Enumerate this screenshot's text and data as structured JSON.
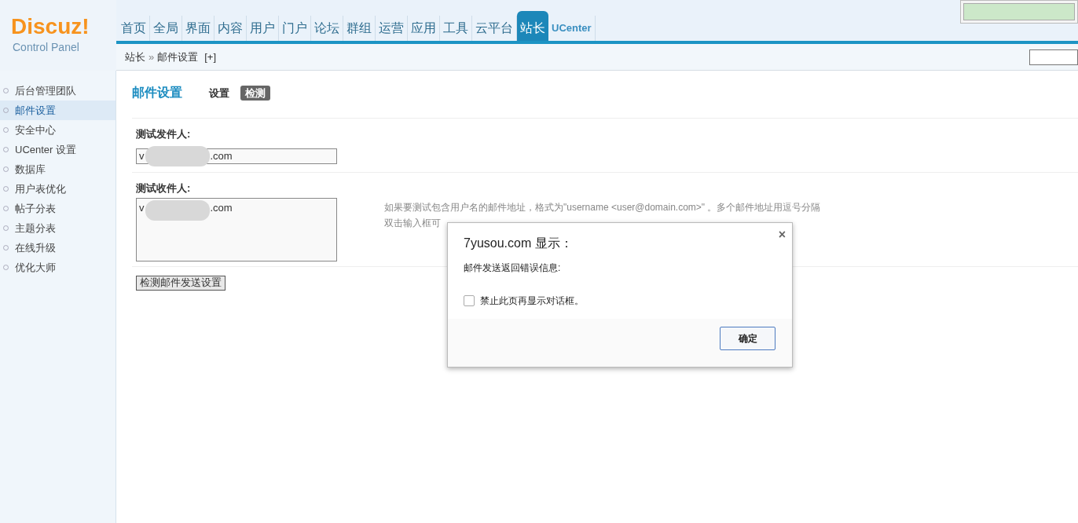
{
  "logo": {
    "title": "Discuz!",
    "subtitle": "Control Panel"
  },
  "nav": [
    {
      "label": "首页",
      "selected": false
    },
    {
      "label": "全局",
      "selected": false
    },
    {
      "label": "界面",
      "selected": false
    },
    {
      "label": "内容",
      "selected": false
    },
    {
      "label": "用户",
      "selected": false
    },
    {
      "label": "门户",
      "selected": false
    },
    {
      "label": "论坛",
      "selected": false
    },
    {
      "label": "群组",
      "selected": false
    },
    {
      "label": "运营",
      "selected": false
    },
    {
      "label": "应用",
      "selected": false
    },
    {
      "label": "工具",
      "selected": false
    },
    {
      "label": "云平台",
      "selected": false
    },
    {
      "label": "站长",
      "selected": true
    },
    {
      "label": "UCenter",
      "selected": false
    }
  ],
  "breadcrumb": {
    "parent": "站长",
    "separator": "»",
    "current": "邮件设置",
    "add": "[+]"
  },
  "sidebar": [
    {
      "label": "后台管理团队",
      "selected": false
    },
    {
      "label": "邮件设置",
      "selected": true
    },
    {
      "label": "安全中心",
      "selected": false
    },
    {
      "label": "UCenter 设置",
      "selected": false
    },
    {
      "label": "数据库",
      "selected": false
    },
    {
      "label": "用户表优化",
      "selected": false
    },
    {
      "label": "帖子分表",
      "selected": false
    },
    {
      "label": "主题分表",
      "selected": false
    },
    {
      "label": "在线升级",
      "selected": false
    },
    {
      "label": "优化大师",
      "selected": false
    }
  ],
  "page": {
    "title": "邮件设置",
    "tabs": [
      {
        "label": "设置",
        "selected": false
      },
      {
        "label": "检测",
        "selected": true
      }
    ]
  },
  "form": {
    "sender": {
      "label": "测试发件人:",
      "value_start": "v",
      "value_end": ".com"
    },
    "recipient": {
      "label": "测试收件人:",
      "value_start": "v",
      "value_end": ".com",
      "hint": [
        "如果要测试包含用户名的邮件地址，格式为\"username <user@domain.com>\" 。多个邮件地址用逗号分隔",
        "双击输入框可"
      ]
    },
    "submit": "检测邮件发送设置"
  },
  "dialog": {
    "title": "7yusou.com 显示：",
    "close": "×",
    "message": "邮件发送返回错误信息:",
    "checkbox": {
      "label": "禁止此页再显示对话框。",
      "checked": false
    },
    "ok": "确定"
  }
}
